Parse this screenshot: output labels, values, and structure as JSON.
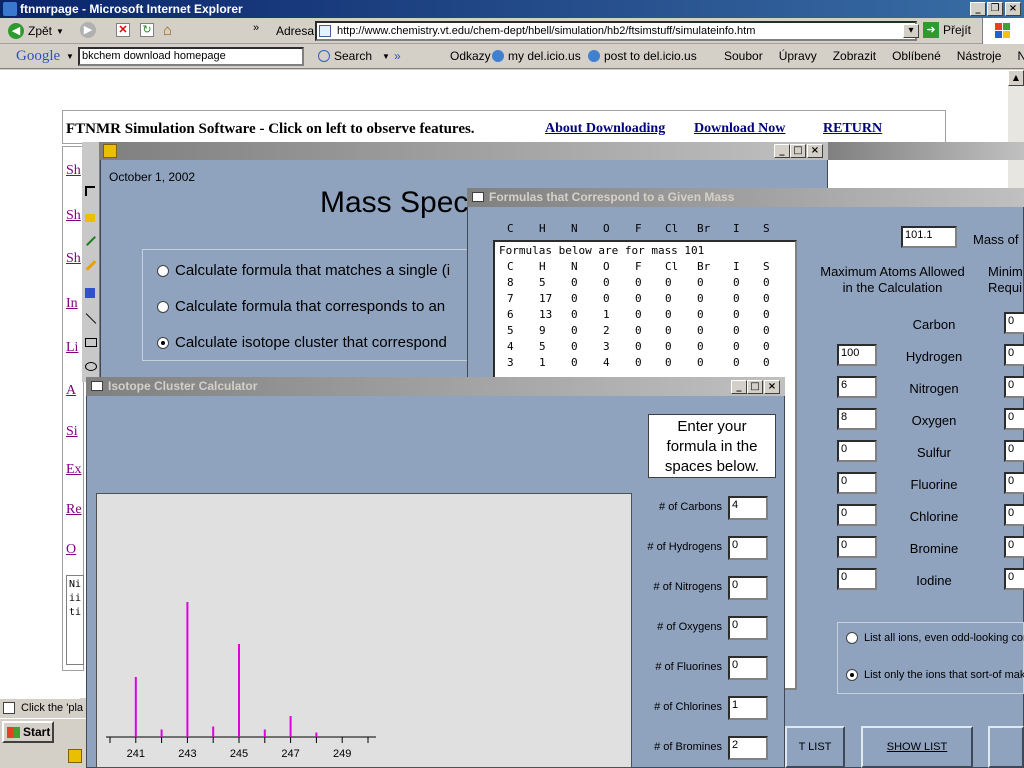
{
  "browser": {
    "title": "ftnmrpage - Microsoft Internet Explorer",
    "back_label": "Zpět",
    "address_label": "Adresa",
    "url": "http://www.chemistry.vt.edu/chem-dept/hbell/simulation/hb2/ftsimstuff/simulateinfo.htm",
    "go_label": "Přejít",
    "google_label": "Google",
    "search_text": "bkchem download homepage",
    "search_label": "Search",
    "links_label": "Odkazy",
    "links": [
      "my del.icio.us",
      "post to del.icio.us"
    ],
    "menus": [
      "Soubor",
      "Úpravy",
      "Zobrazit",
      "Oblíbené",
      "Nástroje",
      "Ná"
    ],
    "status_text": "Click the 'pla"
  },
  "page": {
    "header_title": "FTNMR Simulation Software - Click on left to observe features.",
    "links": [
      "About Downloading",
      "Download Now",
      "RETURN"
    ],
    "left_links": [
      "Sh",
      "Sh",
      "Sh",
      "In",
      "Li",
      "A",
      "Si",
      "Ex",
      "Re",
      "O"
    ],
    "textarea_lines": [
      "Ni",
      "ii",
      "ti"
    ]
  },
  "mass_window": {
    "date": "October 1, 2002",
    "title": "Mass Spec",
    "options": [
      "Calculate formula that matches a single (i",
      "Calculate formula that corresponds to an",
      "Calculate isotope cluster that correspond"
    ],
    "selected_option": 2
  },
  "formulas_window": {
    "title": "Formulas that Correspond to a Given Mass",
    "columns": [
      "C",
      "H",
      "N",
      "O",
      "F",
      "Cl",
      "Br",
      "I",
      "S"
    ],
    "list_header": "Formulas below are for mass 101",
    "list_columns": [
      "C",
      "H",
      "N",
      "O",
      "F",
      "Cl",
      "Br",
      "I",
      "S"
    ],
    "rows": [
      [
        "8",
        "5",
        "0",
        "0",
        "0",
        "0",
        "0",
        "0",
        "0"
      ],
      [
        "7",
        "17",
        "0",
        "0",
        "0",
        "0",
        "0",
        "0",
        "0"
      ],
      [
        "6",
        "13",
        "0",
        "1",
        "0",
        "0",
        "0",
        "0",
        "0"
      ],
      [
        "5",
        "9",
        "0",
        "2",
        "0",
        "0",
        "0",
        "0",
        "0"
      ],
      [
        "4",
        "5",
        "0",
        "3",
        "0",
        "0",
        "0",
        "0",
        "0"
      ],
      [
        "3",
        "1",
        "0",
        "4",
        "0",
        "0",
        "0",
        "0",
        "0"
      ]
    ],
    "mass_value": "101.1",
    "mass_label": "Mass of",
    "max_atoms_label": "Maximum Atoms Allowed in the Calculation",
    "min_label": "Minim Requi",
    "elements": [
      {
        "name": "Carbon",
        "max": "",
        "min": "0"
      },
      {
        "name": "Hydrogen",
        "max": "100",
        "min": "0"
      },
      {
        "name": "Nitrogen",
        "max": "6",
        "min": "0"
      },
      {
        "name": "Oxygen",
        "max": "8",
        "min": "0"
      },
      {
        "name": "Sulfur",
        "max": "0",
        "min": "0"
      },
      {
        "name": "Fluorine",
        "max": "0",
        "min": "0"
      },
      {
        "name": "Chlorine",
        "max": "0",
        "min": "0"
      },
      {
        "name": "Bromine",
        "max": "0",
        "min": "0"
      },
      {
        "name": "Iodine",
        "max": "0",
        "min": "0"
      }
    ],
    "list_options": [
      "List all ions, even odd-looking com",
      "List only the ions that sort-of make"
    ],
    "list_selected": 1,
    "buttons": [
      "T LIST",
      "SHOW LIST"
    ]
  },
  "isotope_window": {
    "title": "Isotope Cluster Calculator",
    "instructions": "Enter your formula in the spaces below.",
    "fields": [
      {
        "label": "# of Carbons",
        "value": "4"
      },
      {
        "label": "# of Hydrogens",
        "value": "0"
      },
      {
        "label": "# of Nitrogens",
        "value": "0"
      },
      {
        "label": "# of Oxygens",
        "value": "0"
      },
      {
        "label": "# of Fluorines",
        "value": "0"
      },
      {
        "label": "# of Chlorines",
        "value": "1"
      },
      {
        "label": "# of Bromines",
        "value": "2"
      }
    ],
    "bar_color": "#e000e0"
  },
  "chart_data": {
    "type": "bar",
    "x": [
      241,
      242,
      243,
      244,
      245,
      246,
      247,
      248
    ],
    "values": [
      40,
      5,
      90,
      7,
      62,
      5,
      14,
      3
    ],
    "tick_labels": [
      "241",
      "243",
      "245",
      "247",
      "249"
    ],
    "xlim": [
      240,
      250
    ],
    "ylim": [
      0,
      100
    ]
  },
  "taskbar": {
    "start_label": "Start"
  }
}
